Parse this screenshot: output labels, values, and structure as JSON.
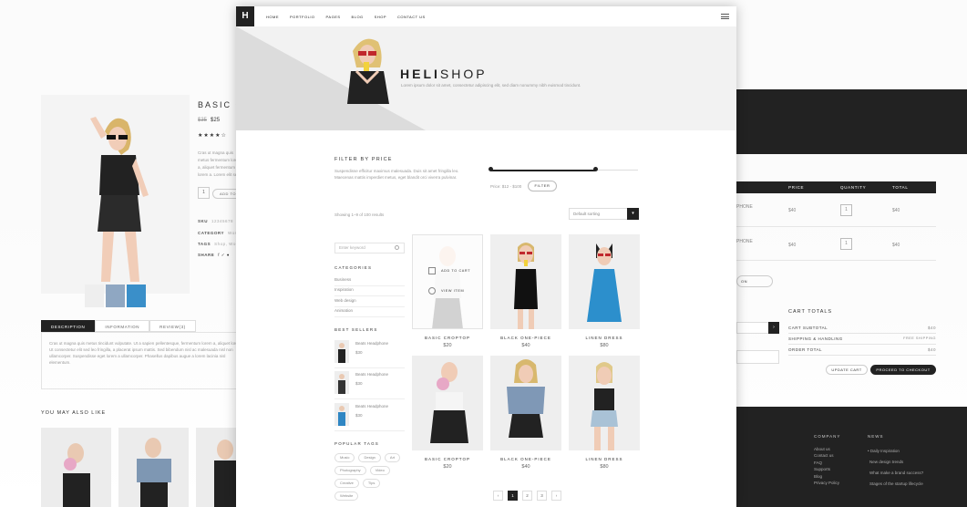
{
  "left_page": {
    "title": "BASIC C",
    "old_price": "$35",
    "price": "$25",
    "stars": "★★★★☆",
    "desc": "Cras ut magna quis metus fermentum lorem a, aliquet fermentum lorem a. Lorem elit sed.",
    "qty": "1",
    "add_to_cart": "ADD TO",
    "sku_label": "SKU",
    "sku_value": "12345678",
    "category_label": "CATEGORY",
    "category_value": "Wom",
    "tags_label": "TAGS",
    "tags_value": "Shop, Wom",
    "share_label": "SHARE",
    "share_icons": "f ✓ ●",
    "tabs": [
      "DESCRIPTION",
      "INFORMATION",
      "REVIEW(3)"
    ],
    "tab_body": "Cras ut magna quis metus tincidunt vulputate. Ut a sapien pellentesque, fermentum lorem a, aliquet lorem. Ut consectetur elit sed leo fringilla, a placerat ipsum mattis. Sed bibendum nisl ac malesuada nisl non ullamcorper. Suspendisse eget lorem a ullamcorper. Phasellus dapibus augue a lorem lacinia nisl elementum.",
    "also_title": "YOU MAY ALSO LIKE"
  },
  "right_page": {
    "headers": [
      "PRICE",
      "QUANTITY",
      "TOTAL"
    ],
    "rows": [
      {
        "name": "PHONE",
        "price": "$40",
        "qty": "1",
        "total": "$40"
      },
      {
        "name": "PHONE",
        "price": "$40",
        "qty": "1",
        "total": "$40"
      }
    ],
    "coupon": "ON",
    "totals_title": "CART TOTALS",
    "totals": [
      {
        "label": "CART SUBTOTAL",
        "value": "$40"
      },
      {
        "label": "SHIPPING & HANDLING",
        "value": "FREE SHIPPING"
      },
      {
        "label": "ORDER TOTAL",
        "value": "$40"
      }
    ],
    "update_cart": "UPDATE CART",
    "checkout": "PROCEED TO CHECKOUT",
    "footer": {
      "company_title": "COMPANY",
      "company_links": [
        "About us",
        "Contact us",
        "FAQ",
        "Supports",
        "Blog",
        "Privacy Policy"
      ],
      "news_title": "NEWS",
      "news_links": [
        "• Daily Inspiration",
        "New design trends",
        "What make a brand success?",
        "Stages of the startup lifecycle"
      ]
    }
  },
  "main": {
    "logo": "H",
    "nav": [
      "HOME",
      "PORTFOLIO",
      "PAGES",
      "BLOG",
      "SHOP",
      "CONTACT US"
    ],
    "hero_title_bold": "HELI",
    "hero_title_light": "SHOP",
    "hero_subtitle": "Lorem ipsum dolor sit amet, consectetur adipiscing elit, sed diam nonummy nibh euismod tincidunt.",
    "filter_title": "FILTER BY PRICE",
    "filter_desc": "Suspendisse efficitur maximus malesuada. Duis sit amet fringilla leo. Maecenas mattis imperdiet metus, eget blandit orci viverra pulvinar.",
    "price_range": "Price: $12 - $100",
    "filter_button": "FILTER",
    "price_slider": {
      "min": 0.0,
      "max": 0.71
    },
    "showing": "Showing 1–9 of 100 results",
    "sort_placeholder": "Default sorting",
    "search_placeholder": "Enter keyword",
    "categories_title": "CATEGORIES",
    "categories": [
      "Business",
      "Inspiration",
      "Web design",
      "Animation"
    ],
    "best_title": "BEST SELLERS",
    "best": [
      {
        "name": "Beats Headphone",
        "price": "$30"
      },
      {
        "name": "Beats Headphone",
        "price": "$30"
      },
      {
        "name": "Beats Headphone",
        "price": "$30"
      }
    ],
    "tags_title": "POPULAR TAGS",
    "tags": [
      "Music",
      "Design",
      "Art",
      "Photography",
      "Video",
      "Creative",
      "Tips",
      "Website"
    ],
    "overlay": {
      "add": "ADD TO CART",
      "view": "VIEW ITEM"
    },
    "products": [
      {
        "name": "BASIC CROPTOP",
        "price": "$20"
      },
      {
        "name": "BLACK ONE-PIECE",
        "price": "$40"
      },
      {
        "name": "LINEN DRESS",
        "price": "$80"
      },
      {
        "name": "BASIC CROPTOP",
        "price": "$20"
      },
      {
        "name": "BLACK ONE-PIECE",
        "price": "$40"
      },
      {
        "name": "LINEN DRESS",
        "price": "$80"
      }
    ],
    "pager": [
      "‹",
      "1",
      "2",
      "3",
      "›"
    ]
  }
}
